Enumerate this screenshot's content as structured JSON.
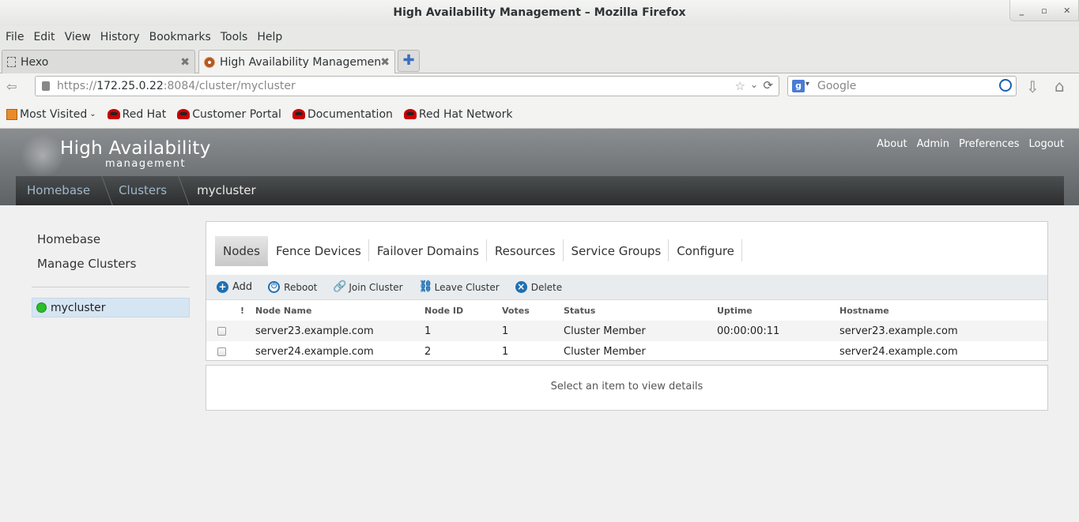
{
  "window": {
    "title": "High Availability Management – Mozilla Firefox",
    "controls": [
      "_",
      "▫",
      "✕"
    ]
  },
  "menu": [
    "File",
    "Edit",
    "View",
    "History",
    "Bookmarks",
    "Tools",
    "Help"
  ],
  "tabs": [
    {
      "label": "Hexo",
      "close": "✖"
    },
    {
      "label": "High Availability Management",
      "close": "✖"
    }
  ],
  "newtab": "✚",
  "nav": {
    "url_host": "https://",
    "url_domain": "172.25.0.22",
    "url_rest": ":8084/cluster/mycluster",
    "search_engine": "g",
    "search_placeholder": "Google"
  },
  "bookmarks": [
    "Most Visited",
    "Red Hat",
    "Customer Portal",
    "Documentation",
    "Red Hat Network"
  ],
  "app": {
    "title": "High Availability",
    "subtitle": "management",
    "links": [
      "About",
      "Admin",
      "Preferences",
      "Logout"
    ],
    "breadcrumbs": [
      "Homebase",
      "Clusters",
      "mycluster"
    ]
  },
  "sidebar": {
    "links": [
      "Homebase",
      "Manage Clusters"
    ],
    "cluster": "mycluster",
    "cluster_status_color": "#2bbd2b"
  },
  "panel": {
    "tabs": [
      "Nodes",
      "Fence Devices",
      "Failover Domains",
      "Resources",
      "Service Groups",
      "Configure"
    ],
    "toolbar": [
      "Add",
      "Reboot",
      "Join Cluster",
      "Leave Cluster",
      "Delete"
    ],
    "columns": [
      "!",
      "Node Name",
      "Node ID",
      "Votes",
      "Status",
      "Uptime",
      "Hostname"
    ],
    "rows": [
      {
        "name": "server23.example.com",
        "id": "1",
        "votes": "1",
        "status": "Cluster Member",
        "uptime": "00:00:00:11",
        "hostname": "server23.example.com"
      },
      {
        "name": "server24.example.com",
        "id": "2",
        "votes": "1",
        "status": "Cluster Member",
        "uptime": "",
        "hostname": "server24.example.com"
      }
    ],
    "details_placeholder": "Select an item to view details"
  }
}
